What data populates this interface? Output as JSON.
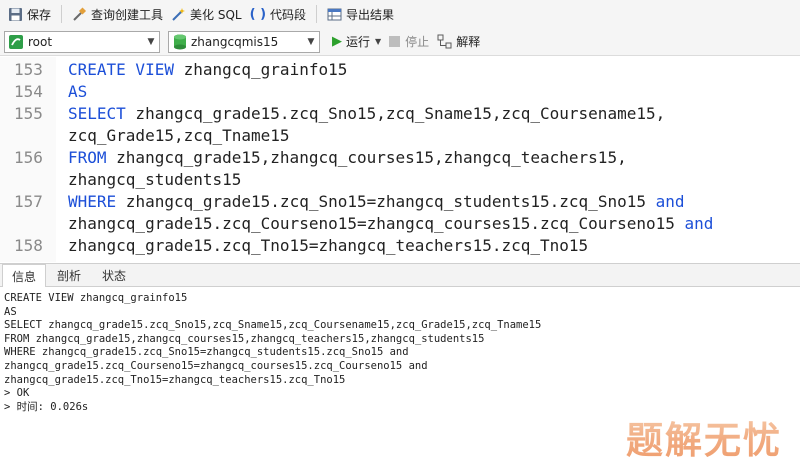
{
  "toolbar": {
    "save_label": "保存",
    "query_builder_label": "查询创建工具",
    "beautify_label": "美化 SQL",
    "snippet_label": "代码段",
    "export_label": "导出结果"
  },
  "connection": {
    "connection_value": "root",
    "database_value": "zhangcqmis15",
    "run_label": "运行",
    "stop_label": "停止",
    "explain_label": "解释"
  },
  "editor": {
    "lines": [
      {
        "num": "153",
        "kw": "CREATE VIEW",
        "rest": " zhangcq_grainfo15",
        "tail_kw": ""
      },
      {
        "num": "154",
        "kw": "AS",
        "rest": "",
        "tail_kw": ""
      },
      {
        "num": "155",
        "kw": "SELECT",
        "rest": " zhangcq_grade15.zcq_Sno15,zcq_Sname15,zcq_Coursename15,",
        "tail_kw": ""
      },
      {
        "num": "",
        "kw": "",
        "rest": "zcq_Grade15,zcq_Tname15",
        "tail_kw": ""
      },
      {
        "num": "156",
        "kw": "FROM",
        "rest": " zhangcq_grade15,zhangcq_courses15,zhangcq_teachers15,",
        "tail_kw": ""
      },
      {
        "num": "",
        "kw": "",
        "rest": "zhangcq_students15",
        "tail_kw": ""
      },
      {
        "num": "157",
        "kw": "WHERE",
        "rest": " zhangcq_grade15.zcq_Sno15=zhangcq_students15.zcq_Sno15 ",
        "tail_kw": "and"
      },
      {
        "num": "",
        "kw": "",
        "rest": "zhangcq_grade15.zcq_Courseno15=zhangcq_courses15.zcq_Courseno15 ",
        "tail_kw": "and"
      },
      {
        "num": "158",
        "kw": "",
        "rest": "zhangcq_grade15.zcq_Tno15=zhangcq_teachers15.zcq_Tno15",
        "tail_kw": ""
      }
    ]
  },
  "result_tabs": {
    "info": "信息",
    "profile": "剖析",
    "status": "状态"
  },
  "output": {
    "lines": [
      "CREATE VIEW zhangcq_grainfo15",
      "AS",
      "SELECT zhangcq_grade15.zcq_Sno15,zcq_Sname15,zcq_Coursename15,zcq_Grade15,zcq_Tname15",
      "FROM zhangcq_grade15,zhangcq_courses15,zhangcq_teachers15,zhangcq_students15",
      "WHERE zhangcq_grade15.zcq_Sno15=zhangcq_students15.zcq_Sno15 and",
      "zhangcq_grade15.zcq_Courseno15=zhangcq_courses15.zcq_Courseno15 and",
      "zhangcq_grade15.zcq_Tno15=zhangcq_teachers15.zcq_Tno15",
      "> OK",
      "> 时间: 0.026s"
    ]
  },
  "watermark": "题解无忧",
  "colors": {
    "keyword": "#1c4fd8",
    "run_green": "#2ca02c",
    "watermark": "#f0a070"
  }
}
